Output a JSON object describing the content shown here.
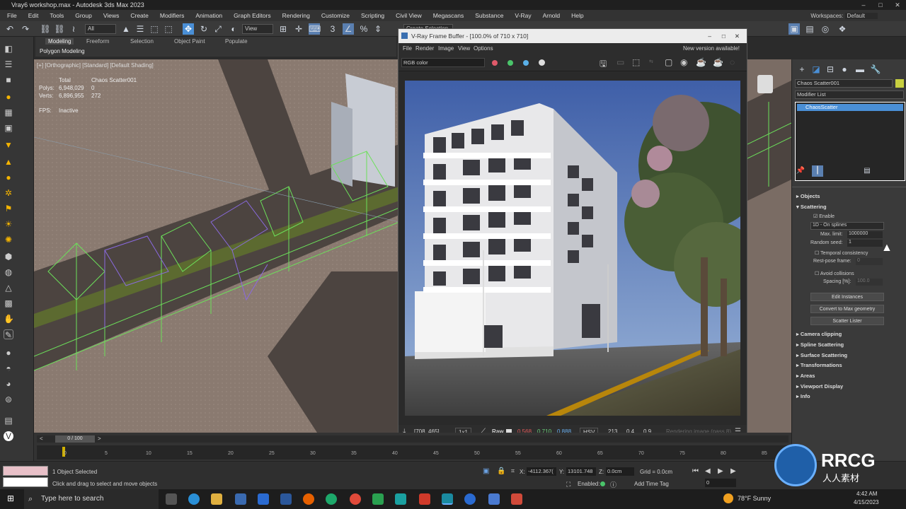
{
  "window": {
    "title": "Vray6 workshop.max - Autodesk 3ds Max 2023"
  },
  "menu": [
    "File",
    "Edit",
    "Tools",
    "Group",
    "Views",
    "Create",
    "Modifiers",
    "Animation",
    "Graph Editors",
    "Rendering",
    "Customize",
    "Scripting",
    "Civil View",
    "Megascans",
    "Substance",
    "V-Ray",
    "Arnold",
    "Help"
  ],
  "workspaces": {
    "label": "Workspaces:",
    "value": "Default"
  },
  "toolbar": {
    "filter": "All",
    "ref_coord": "View",
    "selection_set": "Create Selection Se"
  },
  "ribbon": {
    "tabs": [
      "Modeling",
      "Freeform",
      "Selection",
      "Object Paint",
      "Populate"
    ],
    "active": "Modeling",
    "sub": "Polygon Modeling"
  },
  "viewport": {
    "label": "[+] [Orthographic] [Standard] [Default Shading]",
    "stats": {
      "total_label": "Total",
      "object_name": "Chaos Scatter001",
      "polys_label": "Polys:",
      "polys_total": "6,948,029",
      "polys_sel": "0",
      "verts_label": "Verts:",
      "verts_total": "6,896,955",
      "verts_sel": "272",
      "fps_label": "FPS:",
      "fps_value": "Inactive"
    }
  },
  "vfb": {
    "title": "V-Ray Frame Buffer - [100.0% of 710 x 710]",
    "menu": [
      "File",
      "Render",
      "Image",
      "View",
      "Options"
    ],
    "notice": "New version available!",
    "channel": "RGB color",
    "status": {
      "coords": "[708, 465]",
      "zoom": "1x1",
      "mode": "Raw",
      "r": "0.568",
      "g": "0.710",
      "b": "0.888",
      "color_space": "HSV",
      "h": "213",
      "s": "0.4",
      "v": "0.9",
      "progress": "Rendering image (pass 8)"
    }
  },
  "command_panel": {
    "object_name": "Chaos Scatter001",
    "modifier_list": "Modifier List",
    "stack_item": "ChaosScatter",
    "rollouts": {
      "objects": "Objects",
      "scattering": "Scattering",
      "enable": "Enable",
      "mode": "1D - On splines",
      "max_limit_label": "Max. limit:",
      "max_limit": "1000000",
      "random_seed_label": "Random seed:",
      "random_seed": "1",
      "temporal": "Temporal consistency",
      "rest_pose_label": "Rest-pose frame:",
      "rest_pose": "0",
      "avoid_collisions": "Avoid collisions",
      "spacing_label": "Spacing [%]:",
      "spacing": "100.0",
      "edit_instances": "Edit Instances",
      "convert": "Convert to Max geometry",
      "scatter_lister": "Scatter Lister",
      "collapsed": [
        "Camera clipping",
        "Spline Scattering",
        "Surface Scattering",
        "Transformations",
        "Areas",
        "Viewport Display",
        "Info"
      ]
    }
  },
  "timeline": {
    "frame": "0 / 100",
    "ticks": [
      "0",
      "5",
      "10",
      "15",
      "20",
      "25",
      "30",
      "35",
      "40",
      "45",
      "50",
      "55",
      "60",
      "65",
      "70",
      "75",
      "80",
      "85"
    ]
  },
  "status": {
    "selected": "1 Object Selected",
    "hint": "Click and drag to select and move objects",
    "x_label": "X:",
    "x": "-4112.367(",
    "y_label": "Y:",
    "y": "13101.748",
    "z_label": "Z:",
    "z": "0.0cm",
    "grid": "Grid = 0.0cm",
    "enabled": "Enabled:",
    "add_time_tag": "Add Time Tag",
    "frame_value": "0"
  },
  "taskbar": {
    "search": "Type here to search",
    "weather": "78°F  Sunny",
    "time": "4:42 AM",
    "date": "4/15/2023"
  },
  "watermark": {
    "text": "RRCG",
    "sub": "人人素材"
  },
  "colors": {
    "accent": "#4a8fd6",
    "panel": "#3a3a3a",
    "sky": "#4f6fb0"
  }
}
